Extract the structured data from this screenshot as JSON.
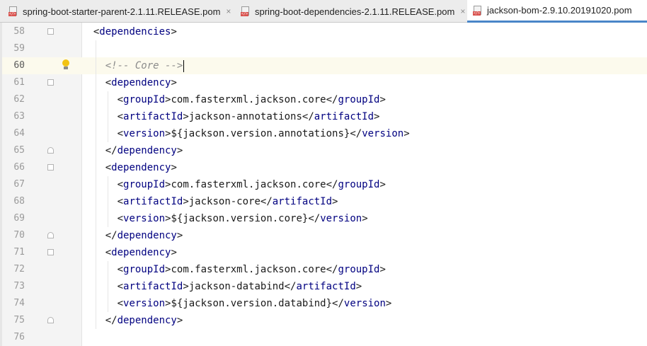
{
  "tabs": [
    {
      "label": "spring-boot-starter-parent-2.1.11.RELEASE.pom",
      "active": false,
      "close": "×"
    },
    {
      "label": "spring-boot-dependencies-2.1.11.RELEASE.pom",
      "active": false,
      "close": "×"
    },
    {
      "label": "jackson-bom-2.9.10.20191020.pom",
      "active": true,
      "close": "×"
    }
  ],
  "editor": {
    "current_line": "60",
    "lines": [
      {
        "num": "58",
        "segments": [
          [
            "p",
            "<"
          ],
          [
            "t",
            "dependencies"
          ],
          [
            "p",
            ">"
          ]
        ]
      },
      {
        "num": "59",
        "segments": []
      },
      {
        "num": "60",
        "segments": [
          [
            "c",
            "<!-- Core -->"
          ]
        ]
      },
      {
        "num": "61",
        "segments": [
          [
            "p",
            "<"
          ],
          [
            "t",
            "dependency"
          ],
          [
            "p",
            ">"
          ]
        ]
      },
      {
        "num": "62",
        "segments": [
          [
            "p",
            "<"
          ],
          [
            "t",
            "groupId"
          ],
          [
            "p",
            ">com.fasterxml.jackson.core</"
          ],
          [
            "t",
            "groupId"
          ],
          [
            "p",
            ">"
          ]
        ]
      },
      {
        "num": "63",
        "segments": [
          [
            "p",
            "<"
          ],
          [
            "t",
            "artifactId"
          ],
          [
            "p",
            ">jackson-annotations</"
          ],
          [
            "t",
            "artifactId"
          ],
          [
            "p",
            ">"
          ]
        ]
      },
      {
        "num": "64",
        "segments": [
          [
            "p",
            "<"
          ],
          [
            "t",
            "version"
          ],
          [
            "p",
            ">${jackson.version.annotations}</"
          ],
          [
            "t",
            "version"
          ],
          [
            "p",
            ">"
          ]
        ]
      },
      {
        "num": "65",
        "segments": [
          [
            "p",
            "</"
          ],
          [
            "t",
            "dependency"
          ],
          [
            "p",
            ">"
          ]
        ]
      },
      {
        "num": "66",
        "segments": [
          [
            "p",
            "<"
          ],
          [
            "t",
            "dependency"
          ],
          [
            "p",
            ">"
          ]
        ]
      },
      {
        "num": "67",
        "segments": [
          [
            "p",
            "<"
          ],
          [
            "t",
            "groupId"
          ],
          [
            "p",
            ">com.fasterxml.jackson.core</"
          ],
          [
            "t",
            "groupId"
          ],
          [
            "p",
            ">"
          ]
        ]
      },
      {
        "num": "68",
        "segments": [
          [
            "p",
            "<"
          ],
          [
            "t",
            "artifactId"
          ],
          [
            "p",
            ">jackson-core</"
          ],
          [
            "t",
            "artifactId"
          ],
          [
            "p",
            ">"
          ]
        ]
      },
      {
        "num": "69",
        "segments": [
          [
            "p",
            "<"
          ],
          [
            "t",
            "version"
          ],
          [
            "p",
            ">${jackson.version.core}</"
          ],
          [
            "t",
            "version"
          ],
          [
            "p",
            ">"
          ]
        ]
      },
      {
        "num": "70",
        "segments": [
          [
            "p",
            "</"
          ],
          [
            "t",
            "dependency"
          ],
          [
            "p",
            ">"
          ]
        ]
      },
      {
        "num": "71",
        "segments": [
          [
            "p",
            "<"
          ],
          [
            "t",
            "dependency"
          ],
          [
            "p",
            ">"
          ]
        ]
      },
      {
        "num": "72",
        "segments": [
          [
            "p",
            "<"
          ],
          [
            "t",
            "groupId"
          ],
          [
            "p",
            ">com.fasterxml.jackson.core</"
          ],
          [
            "t",
            "groupId"
          ],
          [
            "p",
            ">"
          ]
        ]
      },
      {
        "num": "73",
        "segments": [
          [
            "p",
            "<"
          ],
          [
            "t",
            "artifactId"
          ],
          [
            "p",
            ">jackson-databind</"
          ],
          [
            "t",
            "artifactId"
          ],
          [
            "p",
            ">"
          ]
        ]
      },
      {
        "num": "74",
        "segments": [
          [
            "p",
            "<"
          ],
          [
            "t",
            "version"
          ],
          [
            "p",
            ">${jackson.version.databind}</"
          ],
          [
            "t",
            "version"
          ],
          [
            "p",
            ">"
          ]
        ]
      },
      {
        "num": "75",
        "segments": [
          [
            "p",
            "</"
          ],
          [
            "t",
            "dependency"
          ],
          [
            "p",
            ">"
          ]
        ]
      },
      {
        "num": "76",
        "segments": []
      }
    ]
  },
  "icons": {
    "tab_file": "xml-file-icon",
    "gutter_hint": "lightbulb-icon",
    "fold": "fold-marker-icon"
  },
  "colors": {
    "tag": "#000080",
    "comment": "#8c8c8c",
    "current_line": "#fcfaed",
    "active_tab_underline": "#4a86c8"
  }
}
